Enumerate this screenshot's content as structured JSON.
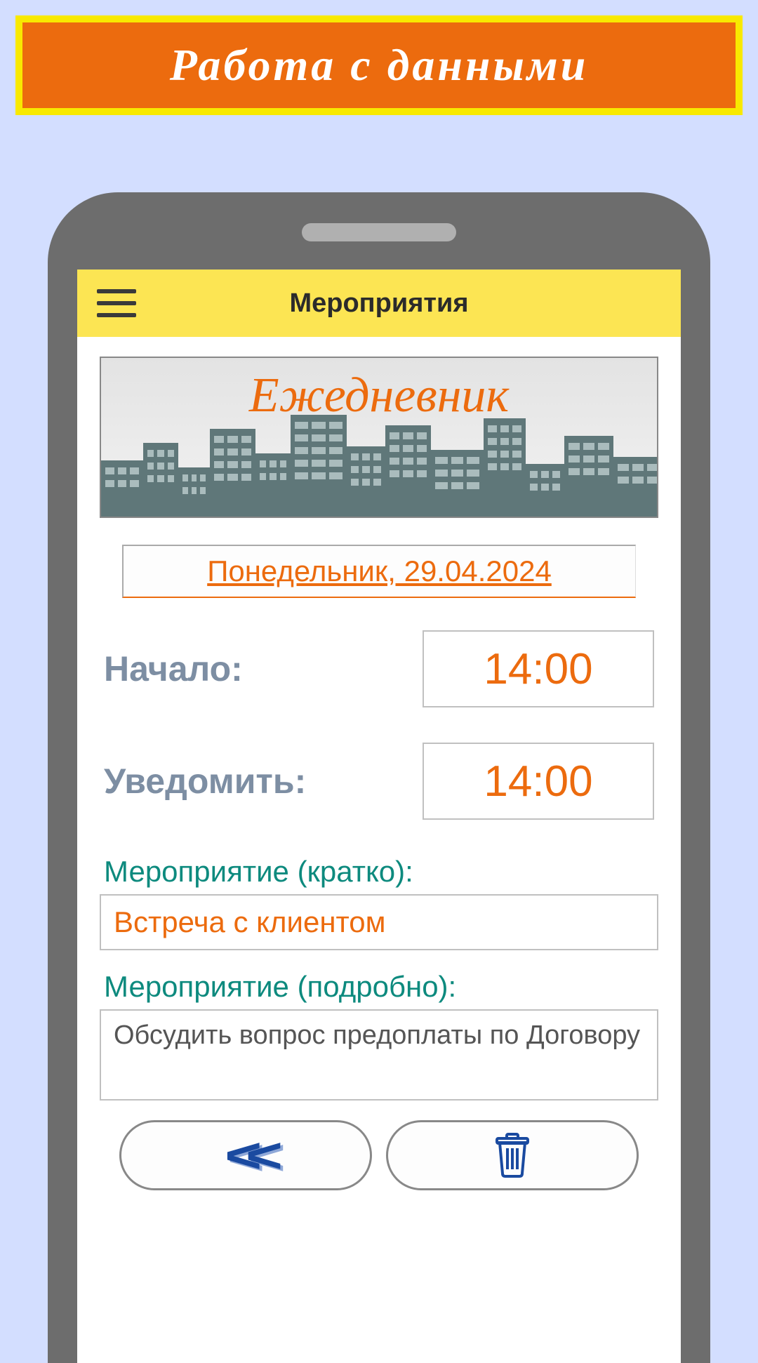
{
  "banner": {
    "title": "Работа с данными"
  },
  "appbar": {
    "title": "Мероприятия"
  },
  "city_banner": {
    "title": "Ежедневник"
  },
  "date": "Понедельник, 29.04.2024",
  "start": {
    "label": "Начало:",
    "value": "14:00"
  },
  "notify": {
    "label": "Уведомить:",
    "value": "14:00"
  },
  "event_short": {
    "label": "Мероприятие (кратко):",
    "value": "Встреча с клиентом"
  },
  "event_detail": {
    "label": "Мероприятие (подробно):",
    "value": "Обсудить вопрос предоплаты по Договору"
  },
  "colors": {
    "accent": "#ec6b0e",
    "appbar": "#fce553",
    "teal": "#0d8a7e",
    "gray_label": "#7d8ea3"
  }
}
